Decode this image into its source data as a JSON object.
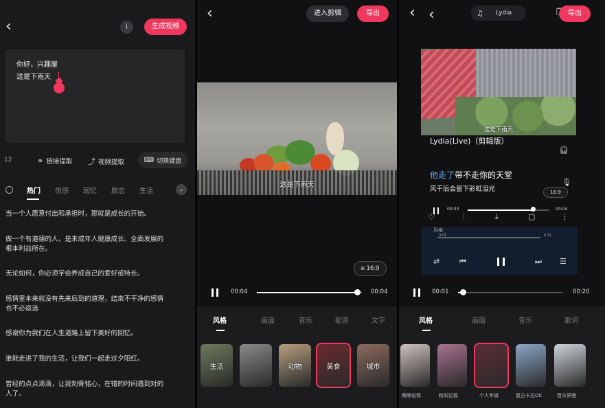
{
  "panel1": {
    "generate_btn": "生成视频",
    "info_btn": "i",
    "editor_lines": [
      "你好，兴趣屋",
      "这是下雨天"
    ],
    "counter": "12",
    "tools": [
      {
        "icon": "link-icon",
        "glyph": "🔗",
        "label": "链接提取"
      },
      {
        "icon": "upload-icon",
        "glyph": "⤴",
        "label": "视频提取"
      }
    ],
    "keyboard_btn": "切换键盘",
    "tabs": [
      "热门",
      "伤感",
      "回忆",
      "励志",
      "生活"
    ],
    "phrases": [
      [
        "当一个人愿意付出和承担时，那就是成长的开始。"
      ],
      [
        "做一个有道德的人，是未成年人健康成长、全面发展的",
        "根本利益所在。"
      ],
      [
        "无论如何，你必须学会养成自己的爱好或特长。"
      ],
      [
        "感情里本来就没有先来后到的道理，结束不干净的感情",
        "也不必返选"
      ],
      [
        "感谢你为我们在人生道路上留下美好的回忆。"
      ],
      [
        "谁能走进了我的生活，让我们一起走过夕阳红。"
      ],
      [
        "曾经的点点滴滴，让我刻骨铭心，在错的时间遇到对的",
        "人了。"
      ]
    ]
  },
  "panel2": {
    "edit_btn": "进入剪辑",
    "export_btn": "导出",
    "subtitle": "这是下雨天",
    "ratio": "16:9",
    "time_start": "00:04",
    "time_end": "00:04",
    "progress": 0.96,
    "tabs": [
      "风格",
      "画面",
      "音乐",
      "配音",
      "文字"
    ],
    "styles": [
      {
        "label": "生活",
        "color": "#6d7a5e"
      },
      {
        "label": "",
        "color": "#8a8a8a"
      },
      {
        "label": "动物",
        "color": "#b79e7f"
      },
      {
        "label": "美食",
        "color": "#6a2a2e"
      },
      {
        "label": "城市",
        "color": "#8c6b5f"
      }
    ]
  },
  "panel3": {
    "export_btn": "导出",
    "music_pill": "Lydia",
    "subtitle": "这是下雨天",
    "song_title": "Lydia(Live)（剪辑版）",
    "lyric_hl": "他走了",
    "lyric_rest": "带不走你的天堂",
    "lyric2": "风干后会留下彩虹泪光",
    "ratio": "16:9",
    "mini_time_start": "00:03",
    "mini_time_end": "00:04",
    "mini_label": "风格",
    "mini_t1": "0:01",
    "mini_t2": "0:11",
    "time_start": "00:01",
    "time_end": "00:20",
    "progress": 0.05,
    "tabs": [
      "风格",
      "画面",
      "音乐",
      "歌词"
    ],
    "styles": [
      {
        "label": "萌眼说情",
        "color": "#cfc2bd"
      },
      {
        "label": "粉彩边框",
        "color": "#a9728f"
      },
      {
        "label": "个人专辑",
        "color": "#5c2c35"
      },
      {
        "label": "复古卡拉OK",
        "color": "#8ba7c7"
      },
      {
        "label": "音乐界面",
        "color": "#cfd4da"
      }
    ]
  }
}
